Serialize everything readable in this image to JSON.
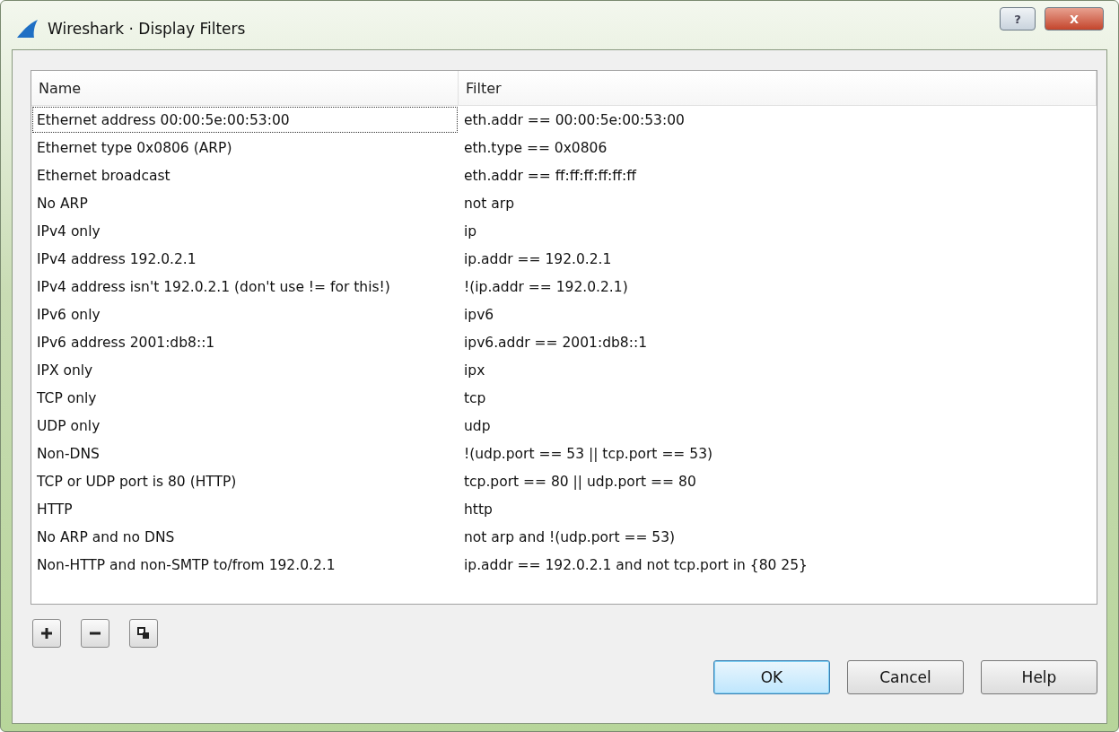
{
  "window": {
    "title": "Wireshark · Display Filters"
  },
  "title_buttons": [
    {
      "kind": "help",
      "label": "?"
    },
    {
      "kind": "close",
      "label": "X"
    }
  ],
  "table": {
    "columns": [
      "Name",
      "Filter"
    ],
    "rows": [
      {
        "name": "Ethernet address 00:00:5e:00:53:00",
        "filter": "eth.addr == 00:00:5e:00:53:00",
        "focused": true
      },
      {
        "name": "Ethernet type 0x0806 (ARP)",
        "filter": "eth.type == 0x0806",
        "focused": false
      },
      {
        "name": "Ethernet broadcast",
        "filter": "eth.addr == ff:ff:ff:ff:ff:ff",
        "focused": false
      },
      {
        "name": "No ARP",
        "filter": "not arp",
        "focused": false
      },
      {
        "name": "IPv4 only",
        "filter": "ip",
        "focused": false
      },
      {
        "name": "IPv4 address 192.0.2.1",
        "filter": "ip.addr == 192.0.2.1",
        "focused": false
      },
      {
        "name": "IPv4 address isn't 192.0.2.1 (don't use != for this!)",
        "filter": "!(ip.addr == 192.0.2.1)",
        "focused": false
      },
      {
        "name": "IPv6 only",
        "filter": "ipv6",
        "focused": false
      },
      {
        "name": "IPv6 address 2001:db8::1",
        "filter": "ipv6.addr == 2001:db8::1",
        "focused": false
      },
      {
        "name": "IPX only",
        "filter": "ipx",
        "focused": false
      },
      {
        "name": "TCP only",
        "filter": "tcp",
        "focused": false
      },
      {
        "name": "UDP only",
        "filter": "udp",
        "focused": false
      },
      {
        "name": "Non-DNS",
        "filter": "!(udp.port == 53 || tcp.port == 53)",
        "focused": false
      },
      {
        "name": "TCP or UDP port is 80 (HTTP)",
        "filter": "tcp.port == 80 || udp.port == 80",
        "focused": false
      },
      {
        "name": "HTTP",
        "filter": "http",
        "focused": false
      },
      {
        "name": "No ARP and no DNS",
        "filter": "not arp and !(udp.port == 53)",
        "focused": false
      },
      {
        "name": "Non-HTTP and non-SMTP to/from 192.0.2.1",
        "filter": "ip.addr == 192.0.2.1 and not tcp.port in {80 25}",
        "focused": false
      }
    ]
  },
  "tool_buttons": [
    {
      "kind": "add"
    },
    {
      "kind": "remove"
    },
    {
      "kind": "copy"
    }
  ],
  "buttons": [
    {
      "label": "OK",
      "default": true
    },
    {
      "label": "Cancel",
      "default": false
    },
    {
      "label": "Help",
      "default": false
    }
  ]
}
